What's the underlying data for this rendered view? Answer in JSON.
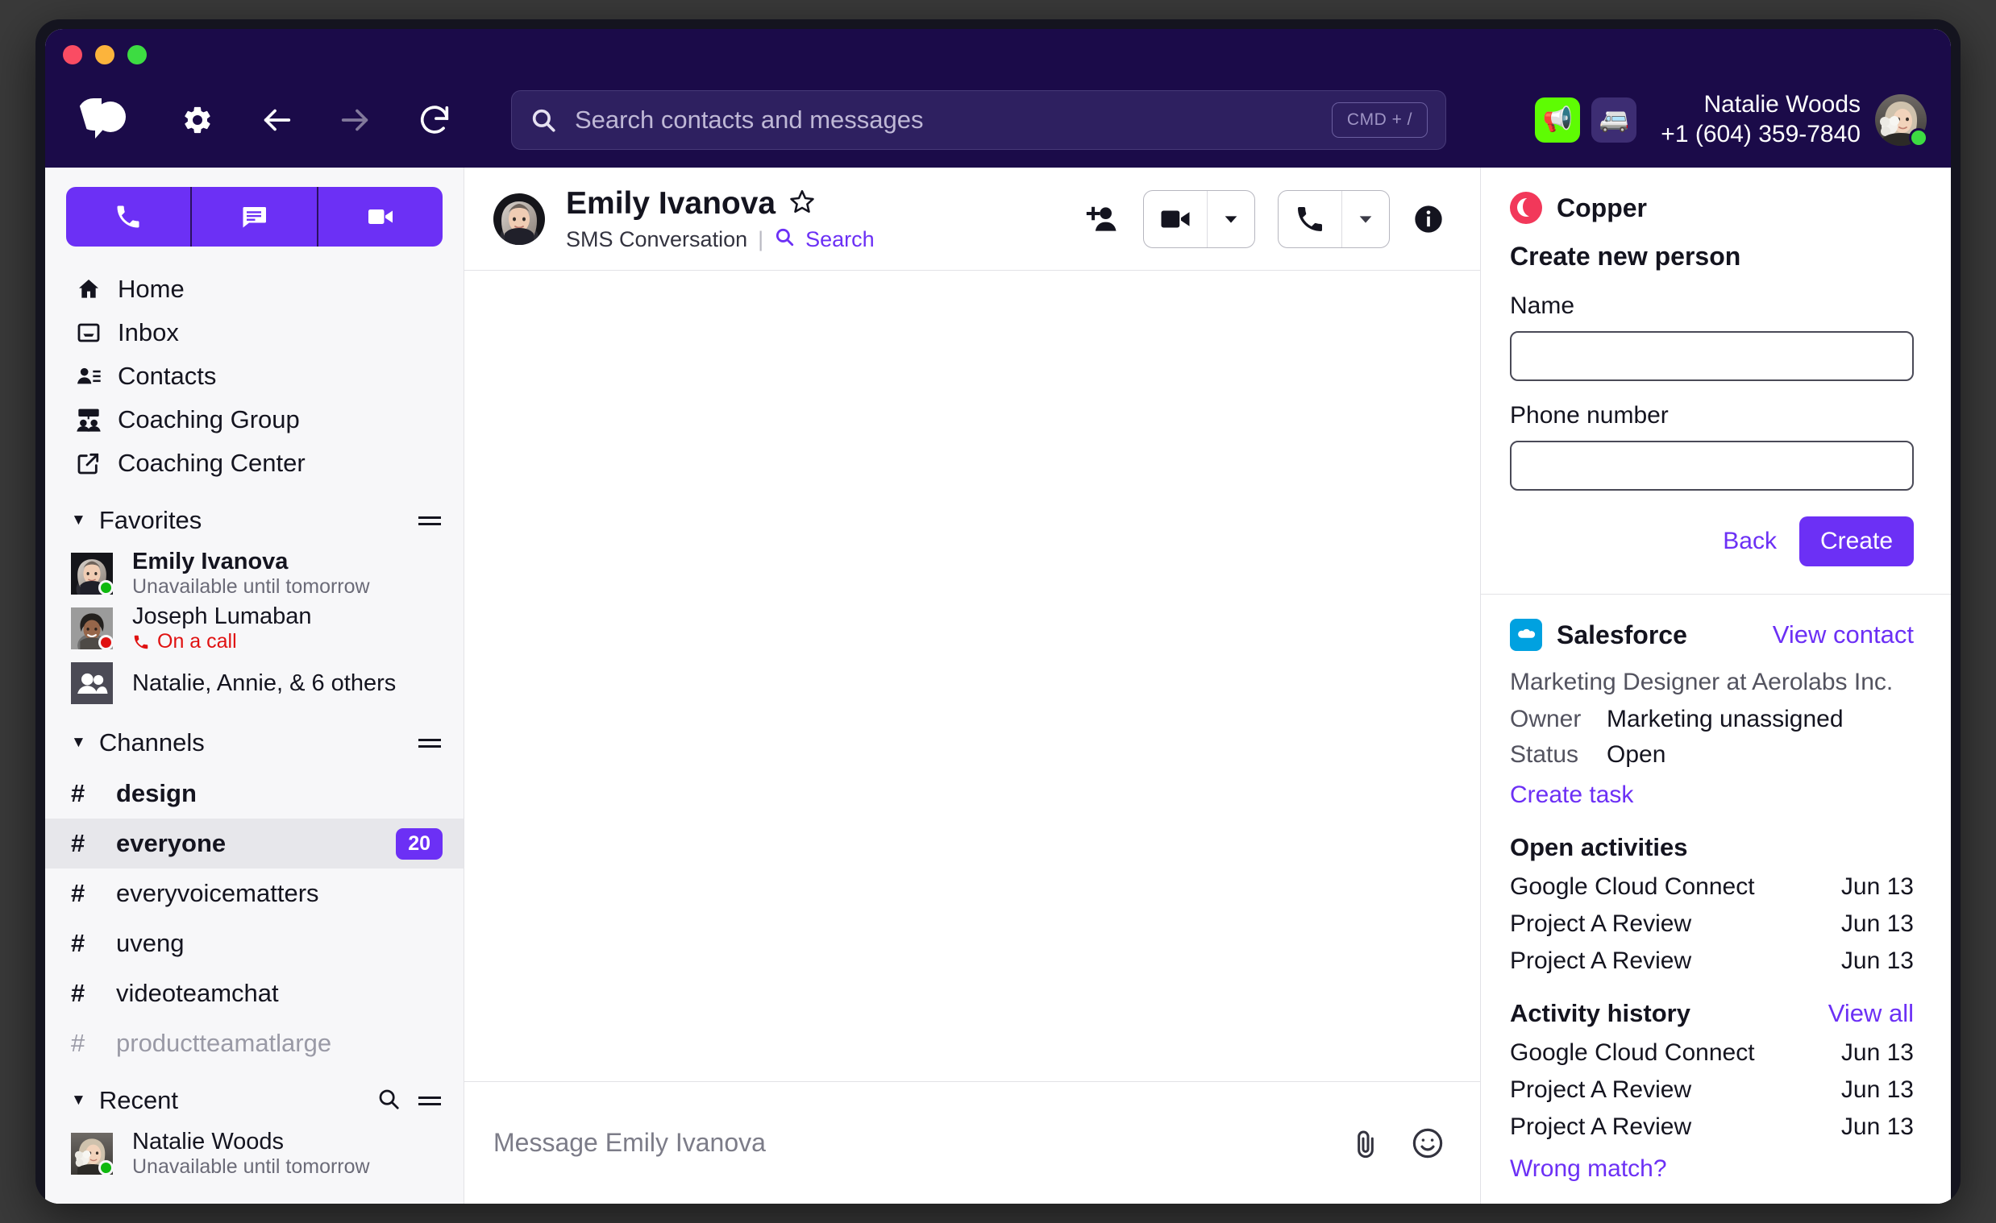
{
  "window": {
    "traffic_lights": [
      "close",
      "minimize",
      "maximize"
    ]
  },
  "topbar": {
    "logo": "dialpad-logo",
    "settings_icon": "gear-icon",
    "back_icon": "arrow-left-icon",
    "forward_icon": "arrow-right-icon",
    "reload_icon": "reload-icon",
    "search": {
      "placeholder": "Search contacts and messages",
      "value": "",
      "icon": "search-icon",
      "shortcut": "CMD + /"
    },
    "announcement_icon": "megaphone-emoji",
    "announcement_glyph": "📢",
    "shuttle_icon": "minibus-emoji",
    "shuttle_glyph": "🚐",
    "user": {
      "name": "Natalie Woods",
      "phone": "+1 (604) 359-7840",
      "presence": "available"
    }
  },
  "sidebar": {
    "quick_actions": [
      {
        "name": "new-call",
        "icon": "phone-icon"
      },
      {
        "name": "new-message",
        "icon": "message-icon"
      },
      {
        "name": "new-meeting",
        "icon": "video-icon"
      }
    ],
    "nav": [
      {
        "label": "Home",
        "icon": "home-icon"
      },
      {
        "label": "Inbox",
        "icon": "inbox-icon"
      },
      {
        "label": "Contacts",
        "icon": "contacts-icon"
      },
      {
        "label": "Coaching Group",
        "icon": "coaching-group-icon"
      },
      {
        "label": "Coaching Center",
        "icon": "external-link-icon"
      }
    ],
    "favorites": {
      "title": "Favorites",
      "items": [
        {
          "name": "Emily Ivanova",
          "status": "Unavailable until tomorrow",
          "presence": "green",
          "bold": true,
          "avatar": "emily"
        },
        {
          "name": "Joseph Lumaban",
          "status": "On a call",
          "presence": "red",
          "bold": false,
          "avatar": "joseph",
          "status_type": "oncall"
        },
        {
          "name": "Natalie, Annie, & 6 others",
          "status": "",
          "presence": "none",
          "bold": false,
          "avatar": "group"
        }
      ]
    },
    "channels": {
      "title": "Channels",
      "items": [
        {
          "name": "design",
          "badge": "",
          "bold": true,
          "active": false,
          "muted": false
        },
        {
          "name": "everyone",
          "badge": "20",
          "bold": true,
          "active": true,
          "muted": false
        },
        {
          "name": "everyvoicematters",
          "badge": "",
          "bold": false,
          "active": false,
          "muted": false
        },
        {
          "name": "uveng",
          "badge": "",
          "bold": false,
          "active": false,
          "muted": false
        },
        {
          "name": "videoteamchat",
          "badge": "",
          "bold": false,
          "active": false,
          "muted": false
        },
        {
          "name": "productteamatlarge",
          "badge": "",
          "bold": false,
          "active": false,
          "muted": true
        }
      ]
    },
    "recent": {
      "title": "Recent",
      "search_icon": "search-icon",
      "items": [
        {
          "name": "Natalie Woods",
          "status": "Unavailable until tomorrow",
          "presence": "green",
          "avatar": "natalie"
        }
      ]
    }
  },
  "conversation": {
    "contact_name": "Emily Ivanova",
    "favorite_icon": "star-outline-icon",
    "type_label": "SMS Conversation",
    "separator": "|",
    "search_label": "Search",
    "actions": {
      "add_person": "add-person-icon",
      "video": "video-icon",
      "video_caret": "chevron-down-icon",
      "call": "phone-icon",
      "call_caret": "chevron-down-icon",
      "info": "info-icon"
    },
    "composer": {
      "placeholder": "Message Emily Ivanova",
      "value": "",
      "attach_icon": "paperclip-icon",
      "emoji_icon": "emoji-icon"
    }
  },
  "right_panel": {
    "copper": {
      "brand": "Copper",
      "heading": "Create new person",
      "name_label": "Name",
      "name_value": "",
      "phone_label": "Phone number",
      "phone_value": "",
      "back_label": "Back",
      "create_label": "Create"
    },
    "salesforce": {
      "brand": "Salesforce",
      "view_contact_label": "View contact",
      "subtitle": "Marketing Designer at Aerolabs Inc.",
      "fields": [
        {
          "key": "Owner",
          "value": "Marketing unassigned"
        },
        {
          "key": "Status",
          "value": "Open"
        }
      ],
      "create_task_label": "Create task",
      "open_activities": {
        "title": "Open activities",
        "items": [
          {
            "title": "Google Cloud Connect",
            "date": "Jun 13"
          },
          {
            "title": "Project A Review",
            "date": "Jun 13"
          },
          {
            "title": "Project A Review",
            "date": "Jun 13"
          }
        ]
      },
      "activity_history": {
        "title": "Activity history",
        "view_all_label": "View all",
        "items": [
          {
            "title": "Google Cloud Connect",
            "date": "Jun 13"
          },
          {
            "title": "Project A Review",
            "date": "Jun 13"
          },
          {
            "title": "Project A Review",
            "date": "Jun 13"
          }
        ]
      },
      "wrong_match_label": "Wrong match?"
    }
  },
  "colors": {
    "brand_purple": "#6c30f5",
    "titlebar": "#1b0b49",
    "accent_link": "#6c30f5",
    "badge": "#6c30f5",
    "copper_red": "#f2385a",
    "salesforce_blue": "#00a1e0",
    "presence_green": "#0fb90f",
    "presence_red": "#e01111"
  }
}
